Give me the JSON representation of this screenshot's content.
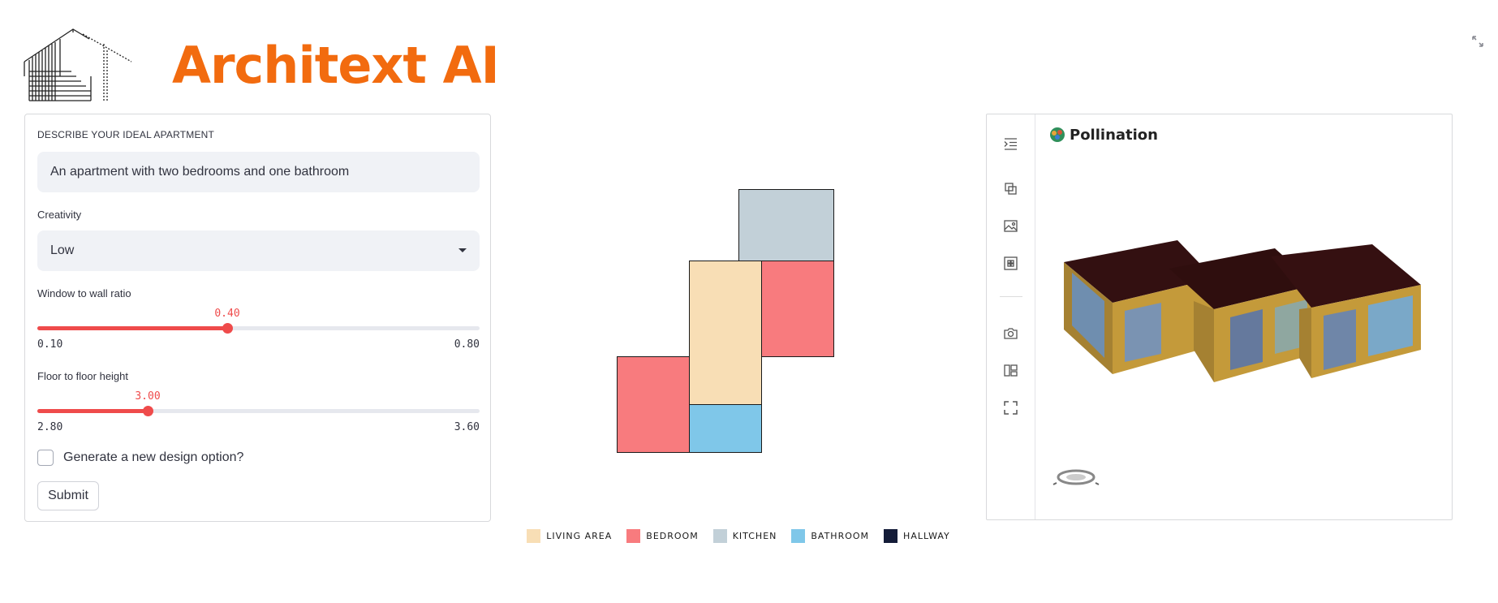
{
  "app": {
    "title": "Architext AI"
  },
  "form": {
    "describe_label": "DESCRIBE YOUR IDEAL APARTMENT",
    "description_value": "An apartment with two bedrooms and one bathroom",
    "creativity_label": "Creativity",
    "creativity_value": "Low",
    "wwr": {
      "label": "Window to wall ratio",
      "value": "0.40",
      "min": "0.10",
      "max": "0.80",
      "fraction": 0.4286
    },
    "ffh": {
      "label": "Floor to floor height",
      "value": "3.00",
      "min": "2.80",
      "max": "3.60",
      "fraction": 0.25
    },
    "checkbox_label": "Generate a new design option?",
    "checked": false,
    "submit_label": "Submit"
  },
  "legend": [
    {
      "label": "LIVING AREA",
      "color": "#f8deb5"
    },
    {
      "label": "BEDROOM",
      "color": "#f87b7e"
    },
    {
      "label": "KITCHEN",
      "color": "#c2d0d8"
    },
    {
      "label": "BATHROOM",
      "color": "#7fc7e9"
    },
    {
      "label": "HALLWAY",
      "color": "#141c38"
    }
  ],
  "viewer": {
    "brand": "Pollination",
    "tools": [
      "indent-icon",
      "layers-icon",
      "image-icon",
      "grid-icon",
      "camera-icon",
      "layout-icon",
      "fullscreen-icon"
    ]
  },
  "colors": {
    "accent": "#ef4b4b",
    "brand_orange": "#f26b0f"
  }
}
